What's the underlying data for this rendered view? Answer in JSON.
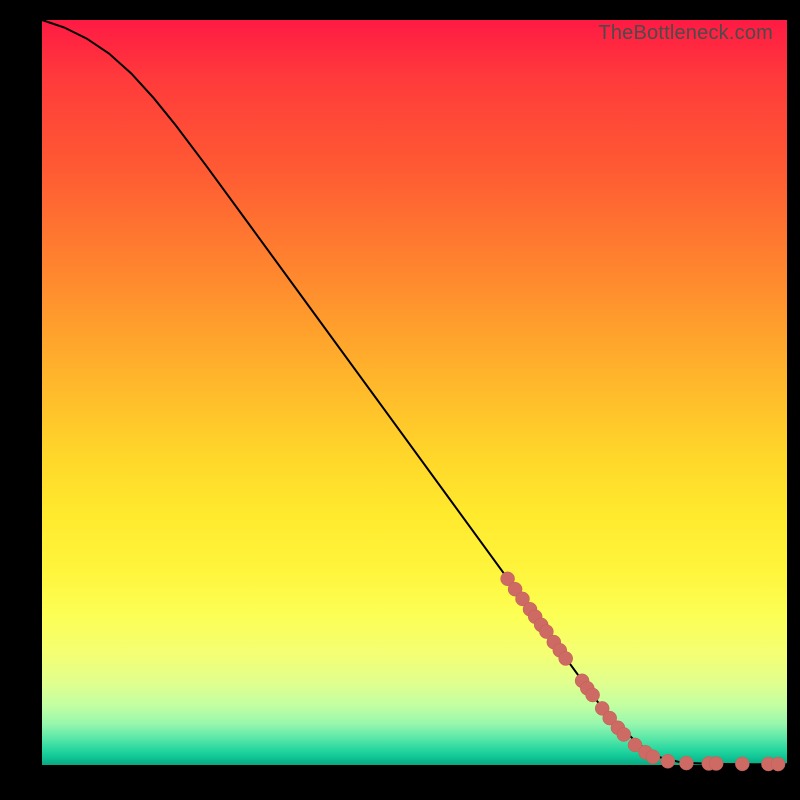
{
  "watermark": "TheBottleneck.com",
  "colors": {
    "background": "#000000",
    "curve": "#000000",
    "marker": "#cc6a63",
    "gradient_top": "#ff1a44",
    "gradient_bottom": "#0aa77f"
  },
  "chart_data": {
    "type": "line",
    "title": "",
    "xlabel": "",
    "ylabel": "",
    "xlim": [
      0,
      100
    ],
    "ylim": [
      0,
      100
    ],
    "curve": [
      {
        "x": 0,
        "y": 100
      },
      {
        "x": 3,
        "y": 99
      },
      {
        "x": 6,
        "y": 97.5
      },
      {
        "x": 9,
        "y": 95.5
      },
      {
        "x": 12,
        "y": 92.8
      },
      {
        "x": 15,
        "y": 89.5
      },
      {
        "x": 18,
        "y": 85.8
      },
      {
        "x": 22,
        "y": 80.5
      },
      {
        "x": 28,
        "y": 72.3
      },
      {
        "x": 35,
        "y": 62.7
      },
      {
        "x": 45,
        "y": 49.0
      },
      {
        "x": 55,
        "y": 35.3
      },
      {
        "x": 65,
        "y": 21.6
      },
      {
        "x": 75,
        "y": 7.9
      },
      {
        "x": 80,
        "y": 2.8
      },
      {
        "x": 83,
        "y": 1.0
      },
      {
        "x": 86,
        "y": 0.3
      },
      {
        "x": 90,
        "y": 0.15
      },
      {
        "x": 95,
        "y": 0.1
      },
      {
        "x": 100,
        "y": 0.1
      }
    ],
    "markers": [
      {
        "x": 62.5,
        "y": 25.0
      },
      {
        "x": 63.5,
        "y": 23.6
      },
      {
        "x": 64.5,
        "y": 22.3
      },
      {
        "x": 65.5,
        "y": 20.9
      },
      {
        "x": 66.2,
        "y": 19.9
      },
      {
        "x": 67.0,
        "y": 18.8
      },
      {
        "x": 67.7,
        "y": 17.9
      },
      {
        "x": 68.7,
        "y": 16.5
      },
      {
        "x": 69.5,
        "y": 15.4
      },
      {
        "x": 70.3,
        "y": 14.3
      },
      {
        "x": 72.5,
        "y": 11.3
      },
      {
        "x": 73.2,
        "y": 10.3
      },
      {
        "x": 73.9,
        "y": 9.4
      },
      {
        "x": 75.2,
        "y": 7.6
      },
      {
        "x": 76.2,
        "y": 6.3
      },
      {
        "x": 77.3,
        "y": 5.0
      },
      {
        "x": 78.1,
        "y": 4.1
      },
      {
        "x": 79.6,
        "y": 2.7
      },
      {
        "x": 81.0,
        "y": 1.7
      },
      {
        "x": 82.0,
        "y": 1.1
      },
      {
        "x": 84.0,
        "y": 0.5
      },
      {
        "x": 86.5,
        "y": 0.25
      },
      {
        "x": 89.5,
        "y": 0.2
      },
      {
        "x": 90.5,
        "y": 0.2
      },
      {
        "x": 94.0,
        "y": 0.15
      },
      {
        "x": 97.5,
        "y": 0.13
      },
      {
        "x": 98.8,
        "y": 0.12
      }
    ]
  }
}
